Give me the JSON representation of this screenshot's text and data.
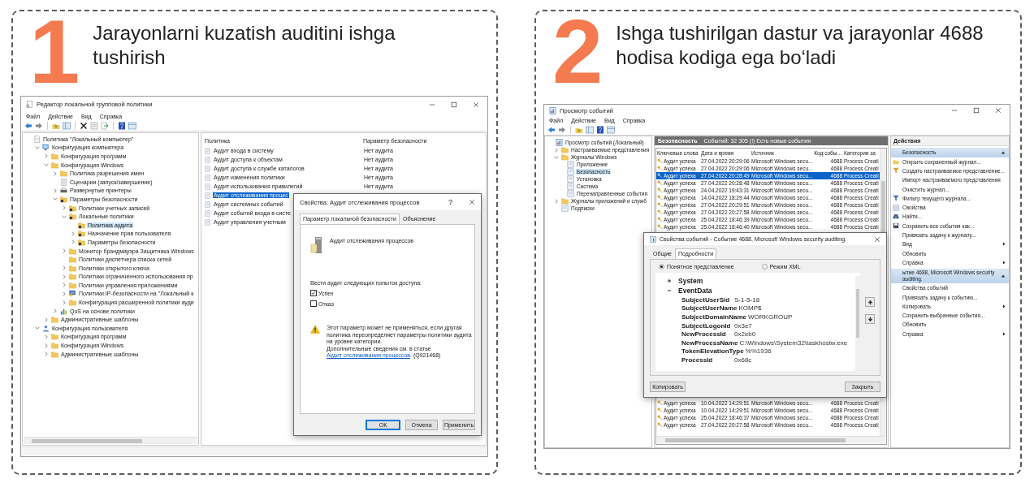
{
  "steps": [
    {
      "number": "1",
      "title": "Jarayonlarni kuzatish auditini ishga tushirish"
    },
    {
      "number": "2",
      "title": "Ishga tushirilgan dastur va jarayonlar 4688 hodisa kodiga ega bo‘ladi"
    }
  ],
  "policy_editor": {
    "title": "Редактор локальной групповой политики",
    "menu": [
      "Файл",
      "Действие",
      "Вид",
      "Справка"
    ],
    "tree": [
      {
        "label": "Политика \"Локальный компьютер\"",
        "kind": "doc",
        "selected": false,
        "children": [
          {
            "label": "Конфигурация компьютера",
            "kind": "computer",
            "selected": false,
            "expanded": true,
            "children": [
              {
                "label": "Конфигурация программ",
                "kind": "folder",
                "selected": false,
                "expanded": false
              },
              {
                "label": "Конфигурация Windows",
                "kind": "folder",
                "selected": false,
                "expanded": true,
                "children": [
                  {
                    "label": "Политика разрешения имен",
                    "kind": "folder",
                    "selected": false,
                    "expanded": false
                  },
                  {
                    "label": "Сценарии (запуск/завершение)",
                    "kind": "script",
                    "selected": false
                  },
                  {
                    "label": "Развернутые принтеры",
                    "kind": "printer",
                    "selected": false,
                    "expanded": false
                  },
                  {
                    "label": "Параметры безопасности",
                    "kind": "secure",
                    "selected": false,
                    "expanded": true,
                    "children": [
                      {
                        "label": "Политики учетных записей",
                        "kind": "secure",
                        "selected": false,
                        "expanded": false
                      },
                      {
                        "label": "Локальные политики",
                        "kind": "secure",
                        "selected": false,
                        "expanded": true,
                        "children": [
                          {
                            "label": "Политика аудита",
                            "kind": "secure",
                            "selected": true
                          },
                          {
                            "label": "Назначение прав пользователя",
                            "kind": "secure",
                            "selected": false,
                            "expanded": false
                          },
                          {
                            "label": "Параметры безопасности",
                            "kind": "secure",
                            "selected": false,
                            "expanded": false
                          }
                        ]
                      },
                      {
                        "label": "Монитор брандмауэра Защитника Windows",
                        "kind": "folder",
                        "selected": false,
                        "expanded": false
                      },
                      {
                        "label": "Политики диспетчера списка сетей",
                        "kind": "folder",
                        "selected": false
                      },
                      {
                        "label": "Политики открытого ключа",
                        "kind": "folder",
                        "selected": false,
                        "expanded": false
                      },
                      {
                        "label": "Политики ограниченного использования пр",
                        "kind": "folder",
                        "selected": false,
                        "expanded": false
                      },
                      {
                        "label": "Политики управления приложениями",
                        "kind": "folder",
                        "selected": false,
                        "expanded": false
                      },
                      {
                        "label": "Политики IP-безопасности на \"Локальный к",
                        "kind": "network",
                        "selected": false,
                        "expanded": false
                      },
                      {
                        "label": "Конфигурация расширенной политики ауди",
                        "kind": "folder",
                        "selected": false,
                        "expanded": false
                      }
                    ]
                  },
                  {
                    "label": "QoS на основе политики",
                    "kind": "chart",
                    "selected": false,
                    "expanded": false
                  }
                ]
              },
              {
                "label": "Административные шаблоны",
                "kind": "folder",
                "selected": false,
                "expanded": false
              }
            ]
          },
          {
            "label": "Конфигурация пользователя",
            "kind": "user",
            "selected": false,
            "expanded": true,
            "children": [
              {
                "label": "Конфигурация программ",
                "kind": "folder",
                "selected": false,
                "expanded": false
              },
              {
                "label": "Конфигурация Windows",
                "kind": "folder",
                "selected": false,
                "expanded": false
              },
              {
                "label": "Административные шаблоны",
                "kind": "folder",
                "selected": false,
                "expanded": false
              }
            ]
          }
        ]
      }
    ],
    "columns": [
      "Политика",
      "Параметр безопасности"
    ],
    "rows": [
      {
        "policy": "Аудит входа в систему",
        "setting": "Нет аудита",
        "selected": false
      },
      {
        "policy": "Аудит доступа к объектам",
        "setting": "Нет аудита",
        "selected": false
      },
      {
        "policy": "Аудит доступа к службе каталогов",
        "setting": "Нет аудита",
        "selected": false
      },
      {
        "policy": "Аудит изменения политики",
        "setting": "Нет аудита",
        "selected": false
      },
      {
        "policy": "Аудит использования привилегий",
        "setting": "Нет аудита",
        "selected": false
      },
      {
        "policy": "Аудит отслеживания процес",
        "selected": true
      },
      {
        "policy": "Аудит системных событий",
        "selected": false
      },
      {
        "policy": "Аудит событий входа в систе",
        "selected": false
      },
      {
        "policy": "Аудит управления учетным",
        "selected": false
      }
    ],
    "dialog": {
      "title": "Свойства: Аудит отслеживания процессов",
      "help": "?",
      "tabs": [
        {
          "label": "Параметр локальной безопасности",
          "selected": true
        },
        {
          "label": "Объяснение",
          "selected": false
        }
      ],
      "policy_name": "Аудит отслеживания процессов",
      "prompt": "Вести аудит следующих попыток доступа:",
      "options": [
        {
          "label": "Успех",
          "checked": true
        },
        {
          "label": "Отказ",
          "checked": false
        }
      ],
      "warning": "Этот параметр может не применяться, если другая политика переопределяет параметры политики аудита на уровне категории.",
      "more_info": {
        "text": "Дополнительные сведения см. в статье",
        "link": "Аудит отслеживания процессов",
        "suffix": ". (Q921468)"
      },
      "buttons": [
        {
          "label": "ОК",
          "default": true
        },
        {
          "label": "Отмена",
          "default": false
        },
        {
          "label": "Применить",
          "default": false
        }
      ]
    }
  },
  "event_viewer": {
    "title": "Просмотр событий",
    "menu": [
      "Файл",
      "Действие",
      "Вид",
      "Справка"
    ],
    "tree": [
      {
        "label": "Просмотр событий (Локальный)",
        "kind": "viewer",
        "selected": false,
        "children": [
          {
            "label": "Настраиваемые представления",
            "kind": "folder",
            "selected": false,
            "expanded": false
          },
          {
            "label": "Журналы Windows",
            "kind": "folder",
            "selected": false,
            "expanded": true,
            "children": [
              {
                "label": "Приложение",
                "kind": "log",
                "selected": false
              },
              {
                "label": "Безопасность",
                "kind": "log",
                "selected": true
              },
              {
                "label": "Установка",
                "kind": "log",
                "selected": false
              },
              {
                "label": "Система",
                "kind": "log",
                "selected": false
              },
              {
                "label": "Перенаправленные события",
                "kind": "log",
                "selected": false
              }
            ]
          },
          {
            "label": "Журналы приложений и служб",
            "kind": "folder",
            "selected": false,
            "expanded": false
          },
          {
            "label": "Подписки",
            "kind": "log",
            "selected": false
          }
        ]
      }
    ],
    "log_header": {
      "name": "Безопасность",
      "summary": "Событий: 32 305 (!) Есть новые события"
    },
    "columns": [
      "Ключевые слова",
      "Дата и время",
      "Источник",
      "Код собы…",
      "Категория за"
    ],
    "rows": [
      {
        "keywords": "Аудит успеха",
        "date": "27.04.2022 20:29:06",
        "source": "Microsoft Windows secu...",
        "code": "4688",
        "category": "Process Creati",
        "selected": false
      },
      {
        "keywords": "Аудит успеха",
        "date": "27.04.2022 20:29:06",
        "source": "Microsoft Windows secu...",
        "code": "4688",
        "category": "Process Creati",
        "selected": false
      },
      {
        "keywords": "Аудит успеха",
        "date": "27.04.2022 20:28:49",
        "source": "Microsoft Windows secu...",
        "code": "4688",
        "category": "Process Creati",
        "selected": true
      },
      {
        "keywords": "Аудит успеха",
        "date": "27.04.2022 20:28:48",
        "source": "Microsoft Windows secu...",
        "code": "4688",
        "category": "Process Creati",
        "selected": false
      },
      {
        "keywords": "Аудит успеха",
        "date": "24.04.2022 19:43:31",
        "source": "Microsoft Windows secu...",
        "code": "4688",
        "category": "Process Creati",
        "selected": false
      },
      {
        "keywords": "Аудит успеха",
        "date": "14.04.2022 18:29:44",
        "source": "Microsoft Windows secu...",
        "code": "4688",
        "category": "Process Creati",
        "selected": false
      },
      {
        "keywords": "Аудит успеха",
        "date": "27.04.2022 20:29:51",
        "source": "Microsoft Windows secu...",
        "code": "4688",
        "category": "Process Creati",
        "selected": false
      },
      {
        "keywords": "Аудит успеха",
        "date": "27.04.2022 20:27:58",
        "source": "Microsoft Windows secu...",
        "code": "4688",
        "category": "Process Creati",
        "selected": false
      },
      {
        "keywords": "Аудит успеха",
        "date": "25.04.2022 18:46:39",
        "source": "Microsoft Windows secu...",
        "code": "4688",
        "category": "Process Creati",
        "selected": false
      },
      {
        "keywords": "Аудит успеха",
        "date": "25.04.2022 18:46:40",
        "source": "Microsoft Windows secu...",
        "code": "4688",
        "category": "Process Creati",
        "selected": false
      }
    ],
    "rows_below_dialog": [
      {
        "keywords": "Аудит успеха",
        "date": "10.04.2022 14:29:51",
        "source": "Microsoft Windows secu...",
        "code": "4688",
        "category": "Process Creati",
        "selected": false
      },
      {
        "keywords": "Аудит успеха",
        "date": "10.04.2022 14:29:51",
        "source": "Microsoft Windows secu...",
        "code": "4688",
        "category": "Process Creati",
        "selected": false
      },
      {
        "keywords": "Аудит успеха",
        "date": "25.04.2022 18:46:37",
        "source": "Microsoft Windows secu...",
        "code": "4688",
        "category": "Process Creati",
        "selected": false
      },
      {
        "keywords": "Аудит успеха",
        "date": "27.04.2022 20:27:58",
        "source": "Microsoft Windows secu...",
        "code": "4688",
        "category": "Process Creati",
        "selected": false
      }
    ],
    "actions": {
      "title": "Действия",
      "sections": [
        {
          "title": "Безопасность",
          "expanded": true,
          "items": [
            {
              "label": "Открыть сохраненный журнал...",
              "kind": "open",
              "submenu": false
            },
            {
              "label": "Создать настраиваемое представление...",
              "kind": "create-filter",
              "submenu": false
            },
            {
              "label": "Импорт настраиваемого представления",
              "kind": "none",
              "submenu": false
            },
            {
              "label": "Очистить журнал...",
              "kind": "none",
              "submenu": false
            },
            {
              "label": "Фильтр текущего журнала...",
              "kind": "filter",
              "submenu": false
            },
            {
              "label": "Свойства",
              "kind": "properties",
              "submenu": false
            },
            {
              "label": "Найти...",
              "kind": "find",
              "submenu": false
            },
            {
              "label": "Сохранить все события как...",
              "kind": "save",
              "submenu": false
            },
            {
              "label": "Привязать задачу к журналу...",
              "kind": "none",
              "submenu": false
            },
            {
              "label": "Вид",
              "kind": "none",
              "submenu": true
            },
            {
              "label": "Обновить",
              "kind": "none",
              "submenu": false
            },
            {
              "label": "Справка",
              "kind": "none",
              "submenu": true
            }
          ]
        },
        {
          "title": "ытие 4688, Microsoft Windows security auditing.",
          "expanded": true,
          "items": [
            {
              "label": "Свойства событий",
              "kind": "none",
              "submenu": false
            },
            {
              "label": "Привязать задачу к событию...",
              "kind": "none",
              "submenu": false
            },
            {
              "label": "Копировать",
              "kind": "none",
              "submenu": true
            },
            {
              "label": "Сохранить выбранные события...",
              "kind": "none",
              "submenu": false
            },
            {
              "label": "Обновить",
              "kind": "none",
              "submenu": false
            },
            {
              "label": "Справка",
              "kind": "none",
              "submenu": true
            }
          ]
        }
      ]
    },
    "dialog": {
      "title": "Свойства событий - Событие 4688, Microsoft Windows security auditing.",
      "tabs": [
        {
          "label": "Общие",
          "selected": false
        },
        {
          "label": "Подробности",
          "selected": true
        }
      ],
      "views": [
        {
          "label": "Понятное представление",
          "selected": true
        },
        {
          "label": "Режим XML",
          "selected": false
        }
      ],
      "sections": [
        {
          "name": "System",
          "expanded": false
        },
        {
          "name": "EventData",
          "expanded": true,
          "fields": [
            {
              "key": "SubjectUserSid",
              "value": "S-1-5-18"
            },
            {
              "key": "SubjectUserName",
              "value": "KOMP$"
            },
            {
              "key": "SubjectDomainName",
              "value": "WORKGROUP"
            },
            {
              "key": "SubjectLogonId",
              "value": "0x3e7"
            },
            {
              "key": "NewProcessId",
              "value": "0x2eb0"
            },
            {
              "key": "NewProcessName",
              "value": "C:\\Windows\\System32\\taskhostw.exe"
            },
            {
              "key": "TokenElevationType",
              "value": "%%1936"
            },
            {
              "key": "ProcessId",
              "value": "0x68c"
            }
          ]
        }
      ],
      "buttons": [
        "Копировать",
        "Закрыть"
      ]
    }
  }
}
